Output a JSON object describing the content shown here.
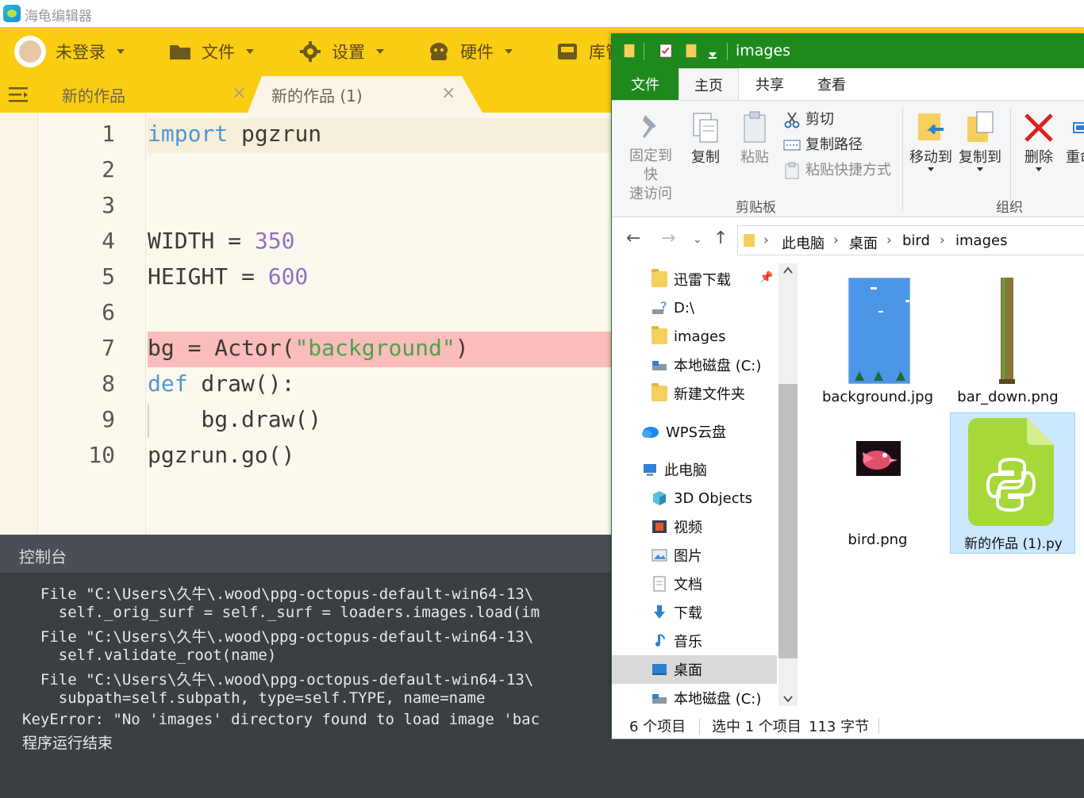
{
  "app": {
    "title": "海龟编辑器"
  },
  "menu": {
    "user": "未登录",
    "file": "文件",
    "settings": "设置",
    "hardware": "硬件",
    "library": "库管"
  },
  "tabs": [
    {
      "label": "新的作品",
      "close": "×"
    },
    {
      "label": "新的作品 (1)",
      "close": "×"
    }
  ],
  "editor": {
    "line_numbers": [
      "1",
      "2",
      "3",
      "4",
      "5",
      "6",
      "7",
      "8",
      "9",
      "10"
    ],
    "lines": {
      "l1_kw": "import",
      "l1_rest": " pgzrun",
      "l4_a": "WIDTH = ",
      "l4_num": "350",
      "l5_a": "HEIGHT = ",
      "l5_num": "600",
      "l7_a": "bg = Actor(",
      "l7_str": "\"background\"",
      "l7_b": ")",
      "l8_kw": "def",
      "l8_rest": " draw():",
      "l9": "    bg.draw()",
      "l10": "pgzrun.go()"
    },
    "error_line": 7
  },
  "console": {
    "title": "控制台",
    "lines": [
      "  File \"C:\\Users\\久牛\\.wood\\ppg-octopus-default-win64-13\\",
      "    self._orig_surf = self._surf = loaders.images.load(im",
      "  File \"C:\\Users\\久牛\\.wood\\ppg-octopus-default-win64-13\\",
      "    self.validate_root(name)",
      "  File \"C:\\Users\\久牛\\.wood\\ppg-octopus-default-win64-13\\",
      "    subpath=self.subpath, type=self.TYPE, name=name",
      "KeyError: \"No 'images' directory found to load image 'bac",
      "程序运行结束"
    ]
  },
  "explorer": {
    "title": "images",
    "ribbon_tabs": [
      "文件",
      "主页",
      "共享",
      "查看"
    ],
    "clipboard": {
      "pin_l1": "固定到快",
      "pin_l2": "速访问",
      "copy": "复制",
      "paste": "粘贴",
      "cut": "剪切",
      "copy_path": "复制路径",
      "paste_shortcut": "粘贴快捷方式",
      "group": "剪贴板"
    },
    "organize": {
      "move_to": "移动到",
      "copy_to": "复制到",
      "delete": "删除",
      "rename": "重命",
      "group": "组织"
    },
    "breadcrumb": [
      "此电脑",
      "桌面",
      "bird",
      "images"
    ],
    "nav_items": [
      {
        "label": "迅雷下载",
        "icon": "folder-icon"
      },
      {
        "label": "D:\\",
        "icon": "drive-icon"
      },
      {
        "label": "images",
        "icon": "folder-icon"
      },
      {
        "label": "本地磁盘 (C:)",
        "icon": "drive-icon"
      },
      {
        "label": "新建文件夹",
        "icon": "folder-icon"
      },
      {
        "label": "WPS云盘",
        "icon": "cloud-icon"
      },
      {
        "label": "此电脑",
        "icon": "computer-icon"
      },
      {
        "label": "3D Objects",
        "icon": "cube-icon"
      },
      {
        "label": "视频",
        "icon": "video-icon"
      },
      {
        "label": "图片",
        "icon": "picture-icon"
      },
      {
        "label": "文档",
        "icon": "document-icon"
      },
      {
        "label": "下载",
        "icon": "download-icon"
      },
      {
        "label": "音乐",
        "icon": "music-icon"
      },
      {
        "label": "桌面",
        "icon": "desktop-icon"
      },
      {
        "label": "本地磁盘 (C:)",
        "icon": "drive-icon"
      }
    ],
    "files": [
      {
        "name": "background.jpg"
      },
      {
        "name": "bar_down.png"
      },
      {
        "name": "bird.png"
      },
      {
        "name": "新的作品 (1).py"
      }
    ],
    "status": {
      "count": "6 个项目",
      "selection": "选中 1 个项目",
      "size": "113 字节"
    }
  },
  "colors": {
    "menu_yellow": "#fbcd12",
    "explorer_green": "#1e8a1e",
    "error_highlight": "#fbbcbc",
    "python_green": "#a6d83a"
  }
}
